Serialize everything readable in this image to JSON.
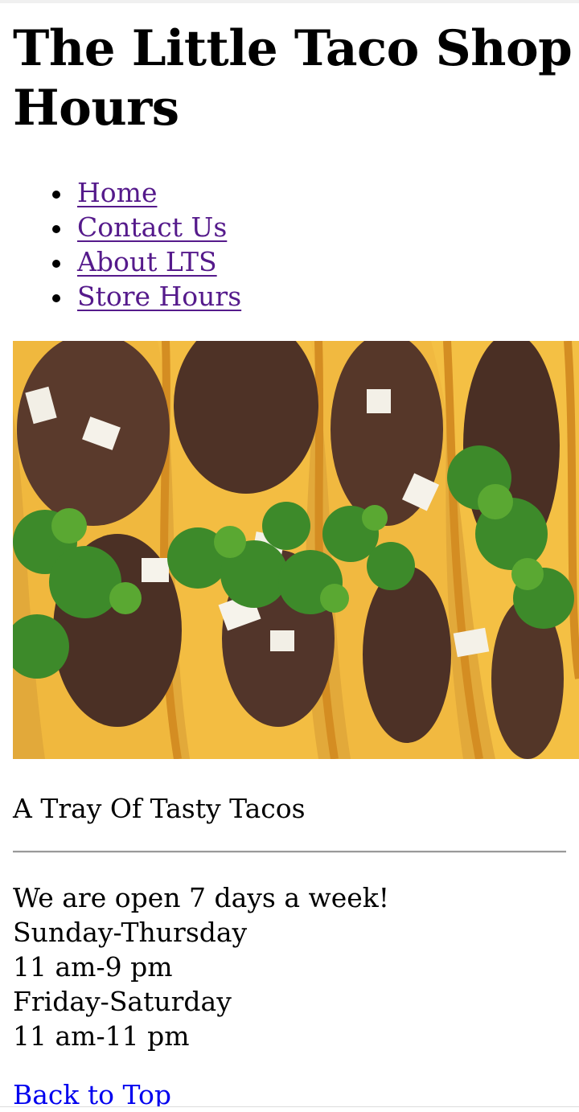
{
  "page": {
    "title": "The Little Taco Shop Hours"
  },
  "nav": {
    "items": [
      {
        "label": "Home"
      },
      {
        "label": "Contact Us"
      },
      {
        "label": "About LTS"
      },
      {
        "label": "Store Hours"
      }
    ],
    "link_color": "#551a8b"
  },
  "hero": {
    "caption": "A Tray Of Tasty Tacos"
  },
  "hours": {
    "lines": [
      "We are open 7 days a week!",
      "Sunday-Thursday",
      "11 am-9 pm",
      "Friday-Saturday",
      "11 am-11 pm"
    ]
  },
  "footer": {
    "back_to_top": "Back to Top",
    "link_color": "#0000ee"
  }
}
